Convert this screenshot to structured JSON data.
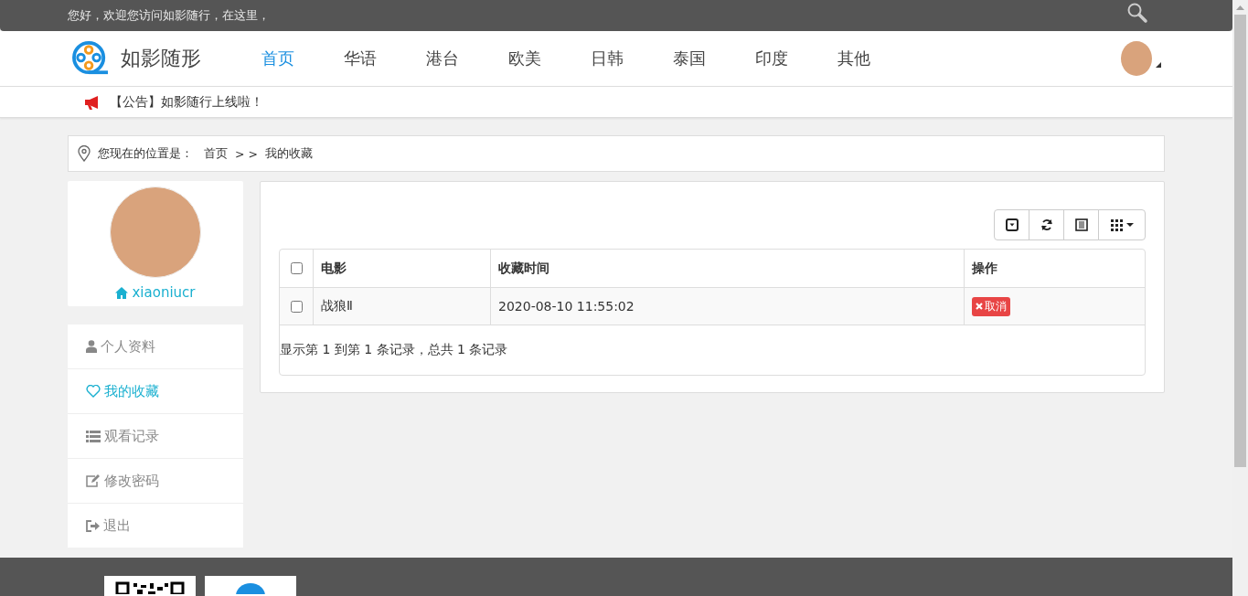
{
  "top_bar": {
    "greeting": "您好，欢迎您访问如影随行，在这里，"
  },
  "header": {
    "logo_text": "如影随形",
    "nav": [
      {
        "label": "首页",
        "selected": true
      },
      {
        "label": "华语",
        "selected": false
      },
      {
        "label": "港台",
        "selected": false
      },
      {
        "label": "欧美",
        "selected": false
      },
      {
        "label": "日韩",
        "selected": false
      },
      {
        "label": "泰国",
        "selected": false
      },
      {
        "label": "印度",
        "selected": false
      },
      {
        "label": "其他",
        "selected": false
      }
    ]
  },
  "notice": "【公告】如影随行上线啦！",
  "breadcrumb": {
    "label": "您现在的位置是：",
    "home": "首页",
    "separator": "> >",
    "current": "我的收藏"
  },
  "profile": {
    "username": "xiaoniucr"
  },
  "menu": [
    {
      "kind": "user",
      "label": "个人资料",
      "selected": false
    },
    {
      "kind": "heart",
      "label": "我的收藏",
      "selected": true
    },
    {
      "kind": "list",
      "label": "观看记录",
      "selected": false
    },
    {
      "kind": "edit",
      "label": "修改密码",
      "selected": false
    },
    {
      "kind": "exit",
      "label": "退出",
      "selected": false
    }
  ],
  "toolbar": [
    {
      "kind": "toggle"
    },
    {
      "kind": "refresh"
    },
    {
      "kind": "columns-list"
    },
    {
      "kind": "grid"
    }
  ],
  "table": {
    "header_checked": false,
    "columns": [
      "电影",
      "收藏时间",
      "操作"
    ],
    "rows": [
      {
        "checked": false,
        "movie": "战狼Ⅱ",
        "time": "2020-08-10 11:55:02",
        "action": "取消"
      }
    ],
    "summary": "显示第 1 到第 1 条记录，总共 1 条记录"
  }
}
